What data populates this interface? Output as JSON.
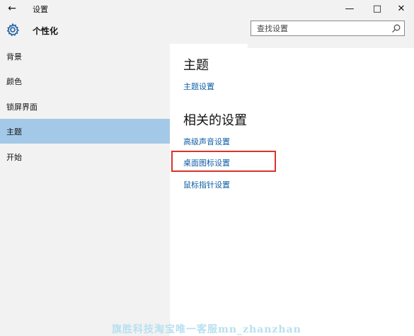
{
  "titlebar": {
    "title": "设置",
    "back_glyph": "←",
    "minimize_glyph": "—",
    "maximize_glyph": "□",
    "close_glyph": "✕"
  },
  "header": {
    "title": "个性化",
    "icon": "gear-icon"
  },
  "search": {
    "placeholder": "查找设置",
    "icon": "search-icon"
  },
  "sidebar": {
    "items": [
      {
        "label": "背景",
        "active": false
      },
      {
        "label": "颜色",
        "active": false
      },
      {
        "label": "锁屏界面",
        "active": false
      },
      {
        "label": "主题",
        "active": true
      },
      {
        "label": "开始",
        "active": false
      }
    ]
  },
  "main": {
    "section1_heading": "主题",
    "theme_settings_link": "主题设置",
    "section2_heading": "相关的设置",
    "links": [
      "高级声音设置",
      "桌面图标设置",
      "鼠标指针设置"
    ],
    "highlighted_link": "桌面图标设置"
  },
  "watermark": "旗胜科技淘宝唯一客服mn_zhanzhan",
  "colors": {
    "accent": "#0f5fa6",
    "selection": "#a4c9e8",
    "highlight_border": "#d9342b",
    "background": "#f2f2f2"
  }
}
